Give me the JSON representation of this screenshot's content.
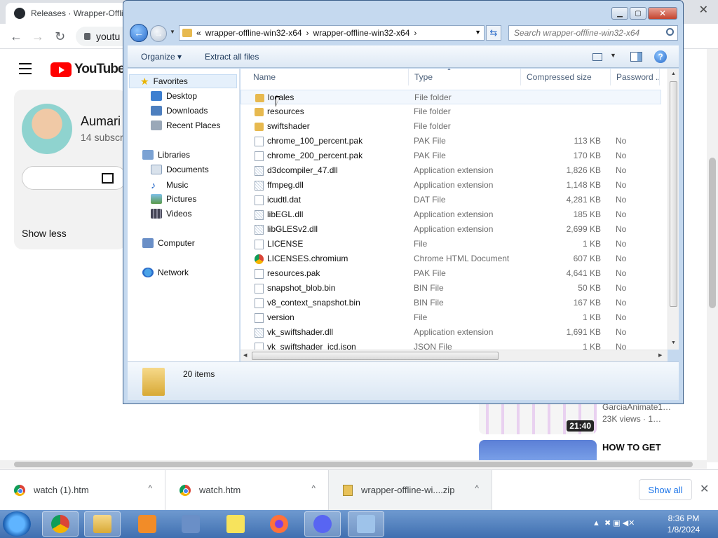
{
  "browser": {
    "tab_title": "Releases · Wrapper-Offlin",
    "address": "youtu"
  },
  "youtube": {
    "logo_text": "YouTube",
    "channel_name": "Aumari",
    "channel_subs": "14 subscr",
    "show_less": "Show less",
    "video1": {
      "duration": "21:40",
      "channel": "GarciaAnimate1…",
      "meta": "23K views · 1…"
    },
    "video2": {
      "title": "HOW TO GET"
    }
  },
  "explorer": {
    "window_buttons": {
      "minimize": "▁",
      "maximize": "▢",
      "close": "✕"
    },
    "address_parts": [
      "«",
      "wrapper-offline-win32-x64",
      "›",
      "wrapper-offline-win32-x64",
      "›"
    ],
    "search_placeholder": "Search wrapper-offline-win32-x64",
    "toolbar": {
      "organize": "Organize ▾",
      "extract": "Extract all files"
    },
    "nav": {
      "favorites": "Favorites",
      "desktop": "Desktop",
      "downloads": "Downloads",
      "recent": "Recent Places",
      "libraries": "Libraries",
      "documents": "Documents",
      "music": "Music",
      "pictures": "Pictures",
      "videos": "Videos",
      "computer": "Computer",
      "network": "Network"
    },
    "columns": {
      "name": "Name",
      "type": "Type",
      "size": "Compressed size",
      "password": "Password ..."
    },
    "files": [
      {
        "name": "locales",
        "type": "File folder",
        "size": "",
        "pwd": "",
        "icon": "folder"
      },
      {
        "name": "resources",
        "type": "File folder",
        "size": "",
        "pwd": "",
        "icon": "folder"
      },
      {
        "name": "swiftshader",
        "type": "File folder",
        "size": "",
        "pwd": "",
        "icon": "folder"
      },
      {
        "name": "chrome_100_percent.pak",
        "type": "PAK File",
        "size": "113 KB",
        "pwd": "No",
        "icon": "file"
      },
      {
        "name": "chrome_200_percent.pak",
        "type": "PAK File",
        "size": "170 KB",
        "pwd": "No",
        "icon": "file"
      },
      {
        "name": "d3dcompiler_47.dll",
        "type": "Application extension",
        "size": "1,826 KB",
        "pwd": "No",
        "icon": "dll"
      },
      {
        "name": "ffmpeg.dll",
        "type": "Application extension",
        "size": "1,148 KB",
        "pwd": "No",
        "icon": "dll"
      },
      {
        "name": "icudtl.dat",
        "type": "DAT File",
        "size": "4,281 KB",
        "pwd": "No",
        "icon": "file"
      },
      {
        "name": "libEGL.dll",
        "type": "Application extension",
        "size": "185 KB",
        "pwd": "No",
        "icon": "dll"
      },
      {
        "name": "libGLESv2.dll",
        "type": "Application extension",
        "size": "2,699 KB",
        "pwd": "No",
        "icon": "dll"
      },
      {
        "name": "LICENSE",
        "type": "File",
        "size": "1 KB",
        "pwd": "No",
        "icon": "file"
      },
      {
        "name": "LICENSES.chromium",
        "type": "Chrome HTML Document",
        "size": "607 KB",
        "pwd": "No",
        "icon": "chrome"
      },
      {
        "name": "resources.pak",
        "type": "PAK File",
        "size": "4,641 KB",
        "pwd": "No",
        "icon": "file"
      },
      {
        "name": "snapshot_blob.bin",
        "type": "BIN File",
        "size": "50 KB",
        "pwd": "No",
        "icon": "file"
      },
      {
        "name": "v8_context_snapshot.bin",
        "type": "BIN File",
        "size": "167 KB",
        "pwd": "No",
        "icon": "file"
      },
      {
        "name": "version",
        "type": "File",
        "size": "1 KB",
        "pwd": "No",
        "icon": "file"
      },
      {
        "name": "vk_swiftshader.dll",
        "type": "Application extension",
        "size": "1,691 KB",
        "pwd": "No",
        "icon": "dll"
      },
      {
        "name": "vk_swiftshader_icd.json",
        "type": "JSON File",
        "size": "1 KB",
        "pwd": "No",
        "icon": "file"
      }
    ],
    "item_count": "20 items"
  },
  "downloads": {
    "items": [
      "watch (1).htm",
      "watch.htm",
      "wrapper-offline-wi....zip"
    ],
    "show_all": "Show all"
  },
  "taskbar": {
    "time": "8:36 PM",
    "date": "1/8/2024"
  },
  "colors": {
    "accent": "#1a73e8",
    "window_frame": "#c5d9ef",
    "youtube_red": "#ff0000"
  }
}
